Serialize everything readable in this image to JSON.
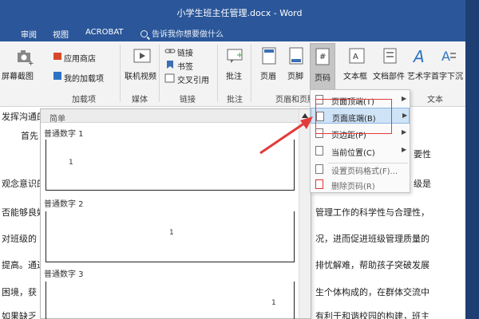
{
  "window": {
    "title": "小学生班主任管理.docx  -  Word"
  },
  "tabs": [
    "审阅",
    "视图",
    "ACROBAT"
  ],
  "tell_me": "告诉我你想要做什么",
  "ribbon": {
    "screenshot": "屏幕截图",
    "app_store": "应用商店",
    "my_addins": "我的加载项",
    "online_video": "联机视频",
    "link": "链接",
    "bookmark": "书签",
    "cross_ref": "交叉引用",
    "comment": "批注",
    "header": "页眉",
    "footer": "页脚",
    "page_number": "页码",
    "textbox": "文本框",
    "doc_parts": "文档部件",
    "wordart": "艺术字",
    "dropcap": "首字下沉",
    "groups": {
      "addins": "加载项",
      "media": "媒体",
      "links": "链接",
      "comments": "批注",
      "header_footer": "页眉和页脚",
      "text": "文本"
    }
  },
  "document": {
    "lines": [
      {
        "left": "发挥沟通的",
        "right": ""
      },
      {
        "left": "首先",
        "right": "要性"
      },
      {
        "left": "观念意识的",
        "right": "级是"
      },
      {
        "left": "否能够良好",
        "right": "管理工作的科学性与合理性，"
      },
      {
        "left": "对班级的",
        "right": "况，进而促进班级管理质量的"
      },
      {
        "left": "提高。通过",
        "right": "排忧解难，帮助孩子突破发展"
      },
      {
        "left": "困境，获",
        "right": "生个体构成的，在群体交流中"
      },
      {
        "left": "如果缺乏",
        "right": "有利于和谐校园的构建，班主"
      }
    ]
  },
  "gallery": {
    "header": "简单",
    "items": [
      {
        "label": "普通数字 1",
        "marker": "1"
      },
      {
        "label": "普通数字 2",
        "marker": "1"
      },
      {
        "label": "普通数字 3",
        "marker": "1"
      }
    ]
  },
  "submenu": {
    "items": [
      {
        "label": "页面顶端(T)",
        "has_arrow": true,
        "enabled": true
      },
      {
        "label": "页面底端(B)",
        "has_arrow": true,
        "enabled": true
      },
      {
        "label": "页边距(P)",
        "has_arrow": true,
        "enabled": true
      },
      {
        "label": "当前位置(C)",
        "has_arrow": true,
        "enabled": true
      },
      {
        "label": "设置页码格式(F)...",
        "has_arrow": false,
        "enabled": true
      },
      {
        "label": "删除页码(R)",
        "has_arrow": false,
        "enabled": true
      }
    ]
  },
  "colors": {
    "title_bar": "#2b579a",
    "highlight": "#cfe3f7",
    "annotation": "#e33b3b"
  }
}
